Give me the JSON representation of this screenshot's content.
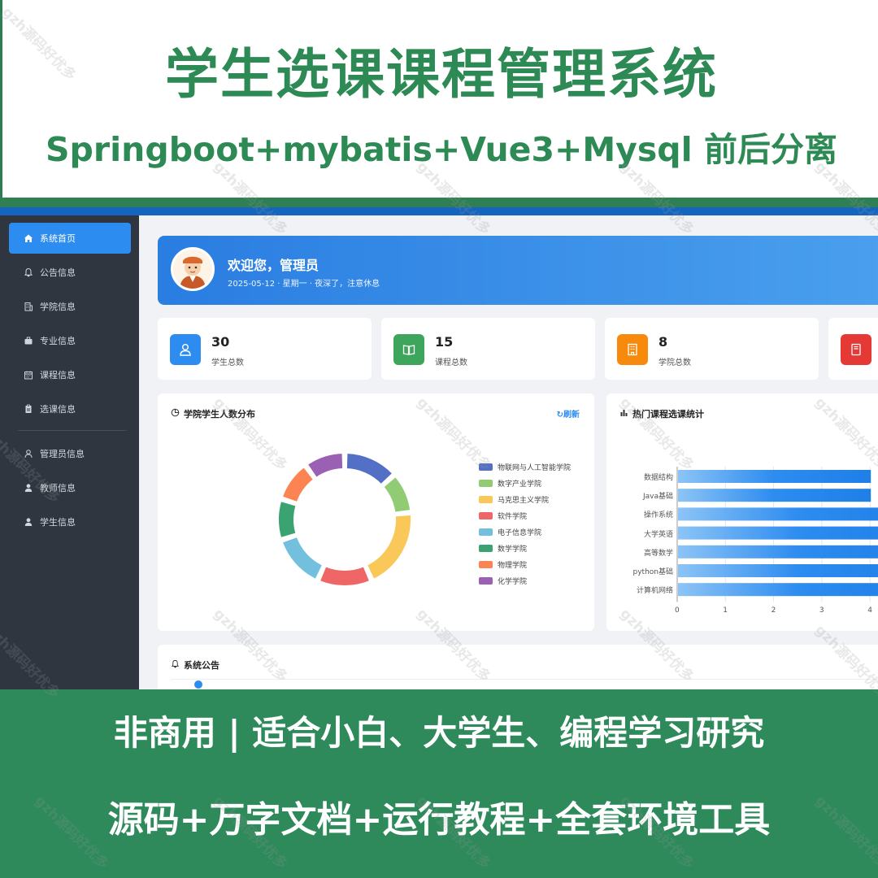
{
  "banner": {
    "title": "学生选课课程管理系统",
    "subtitle": "Springboot+mybatis+Vue3+Mysql 前后分离"
  },
  "sidebar": {
    "items": [
      {
        "label": "系统首页",
        "icon": "home-icon",
        "active": true
      },
      {
        "label": "公告信息",
        "icon": "bell-icon"
      },
      {
        "label": "学院信息",
        "icon": "building-icon"
      },
      {
        "label": "专业信息",
        "icon": "briefcase-icon"
      },
      {
        "label": "课程信息",
        "icon": "calendar-icon"
      },
      {
        "label": "选课信息",
        "icon": "clipboard-icon"
      },
      {
        "label": "管理员信息",
        "icon": "admin-icon"
      },
      {
        "label": "教师信息",
        "icon": "user-icon"
      },
      {
        "label": "学生信息",
        "icon": "user-icon"
      }
    ]
  },
  "welcome": {
    "title": "欢迎您，管理员",
    "subtitle": "2025-05-12 · 星期一 · 夜深了，注意休息"
  },
  "stats": [
    {
      "value": "30",
      "label": "学生总数",
      "color": "#2d8cf0",
      "icon": "user-icon"
    },
    {
      "value": "15",
      "label": "课程总数",
      "color": "#3da55c",
      "icon": "book-icon"
    },
    {
      "value": "8",
      "label": "学院总数",
      "color": "#f7890c",
      "icon": "building-icon"
    },
    {
      "value": "",
      "label": "",
      "color": "#e53935",
      "icon": "notebook-icon"
    }
  ],
  "college_panel": {
    "title": "学院学生人数分布",
    "refresh_label": "刷新"
  },
  "course_panel": {
    "title": "热门课程选课统计"
  },
  "notice_panel": {
    "title": "系统公告"
  },
  "chart_data": [
    {
      "type": "pie",
      "title": "学院学生人数分布",
      "labels": [
        "物联网与人工智能学院",
        "数字产业学院",
        "马克思主义学院",
        "软件学院",
        "电子信息学院",
        "数学学院",
        "物理学院",
        "化学学院"
      ],
      "values": [
        4,
        3,
        6,
        4,
        4,
        3,
        3,
        3
      ],
      "colors": [
        "#5470c6",
        "#91cc75",
        "#fac858",
        "#ee6666",
        "#73c0de",
        "#3ba272",
        "#fc8452",
        "#9a60b4"
      ]
    },
    {
      "type": "bar",
      "orientation": "horizontal",
      "title": "热门课程选课统计",
      "categories": [
        "数据结构",
        "Java基础",
        "操作系统",
        "大学英语",
        "高等数学",
        "python基础",
        "计算机网络"
      ],
      "values": [
        4,
        4,
        5,
        5,
        5,
        5,
        5
      ],
      "x_ticks": [
        "0",
        "1",
        "2",
        "3",
        "4"
      ],
      "xlim": [
        0,
        4
      ]
    }
  ],
  "footer": {
    "line1": "非商用 | 适合小白、大学生、编程学习研究",
    "line2": "源码+万字文档+运行教程+全套环境工具"
  },
  "watermark_text": "gzh源码好优多"
}
